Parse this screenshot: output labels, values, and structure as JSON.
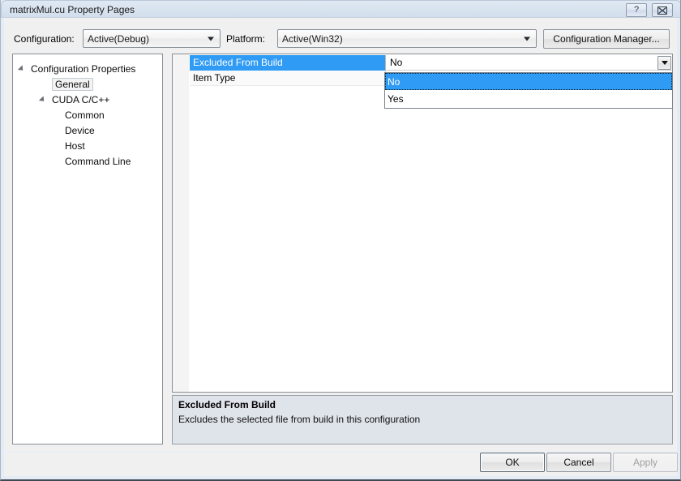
{
  "window": {
    "title": "matrixMul.cu Property Pages",
    "help_button": "?",
    "close_button": "×"
  },
  "toolbar": {
    "configuration_label": "Configuration:",
    "configuration_value": "Active(Debug)",
    "platform_label": "Platform:",
    "platform_value": "Active(Win32)",
    "configuration_manager_button": "Configuration Manager..."
  },
  "tree": {
    "items": [
      {
        "label": "Configuration Properties",
        "indent": 22,
        "expander": true,
        "selected": false
      },
      {
        "label": "General",
        "indent": 52,
        "expander": false,
        "selected": true
      },
      {
        "label": "CUDA C/C++",
        "indent": 48,
        "expander": true,
        "selected": false
      },
      {
        "label": "Common",
        "indent": 64,
        "expander": false,
        "selected": false
      },
      {
        "label": "Device",
        "indent": 64,
        "expander": false,
        "selected": false
      },
      {
        "label": "Host",
        "indent": 64,
        "expander": false,
        "selected": false
      },
      {
        "label": "Command Line",
        "indent": 64,
        "expander": false,
        "selected": false
      }
    ]
  },
  "grid": {
    "rows": [
      {
        "name": "Excluded From Build",
        "value": "No",
        "selected": true
      },
      {
        "name": "Item Type",
        "value": "",
        "selected": false
      }
    ]
  },
  "dropdown": {
    "open": true,
    "options": [
      {
        "label": "No",
        "selected": true
      },
      {
        "label": "Yes",
        "selected": false
      }
    ]
  },
  "description": {
    "title": "Excluded From Build",
    "text": "Excludes the selected file from build in this configuration"
  },
  "footer": {
    "ok_label": "OK",
    "cancel_label": "Cancel",
    "apply_label": "Apply",
    "apply_disabled": true
  },
  "colors": {
    "accent": "#2f9bf4",
    "titlebar": "#d9e4f0",
    "dialog_bg": "#f0f0f0",
    "description_bg": "#dfe3ea"
  }
}
